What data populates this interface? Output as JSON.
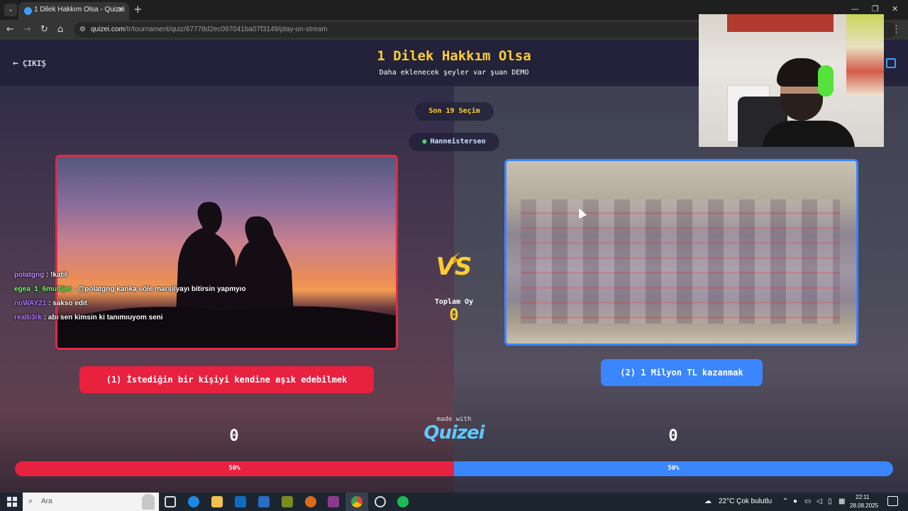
{
  "browser": {
    "tab_title": "1 Dilek Hakkım Olsa - Quizei",
    "new_tab_symbol": "+",
    "close_symbol": "✕",
    "url_domain": "quizei.com",
    "url_path": "/tr/tournament/quiz/67778d2ec097041ba07f3149/play-on-stream"
  },
  "header": {
    "exit_label": "ÇIKIŞ",
    "title": "1 Dilek Hakkım Olsa",
    "subtitle": "Daha eklenecek şeyler var şuan DEMO"
  },
  "pills": {
    "recent": "Son 19 Seçim",
    "user": "Hanneisterseo"
  },
  "center": {
    "vs": "VS",
    "total_label": "Toplam Oy",
    "total_value": "0",
    "made_with": "made with",
    "logo": "Quizei"
  },
  "options": [
    {
      "label": "(1) İstediğin bir kişiyi kendine aşık edebilmek",
      "score": "0",
      "percent_label": "50%",
      "percent": 50,
      "color": "#e8213f"
    },
    {
      "label": "(2) 1 Milyon TL kazanmak",
      "score": "0",
      "percent_label": "50%",
      "percent": 50,
      "color": "#3a86ff"
    }
  ],
  "chat": [
    {
      "user": "polatgng",
      "message": ": !katil",
      "color": "#c58cff"
    },
    {
      "user": "egea_1_6multijet",
      "message": ": @polatgng kanka söle marsilyayı bitirsin yapmyıo",
      "color": "#7dff6a"
    },
    {
      "user": "noWAY21",
      "message": ": sakso edit",
      "color": "#a87bff"
    },
    {
      "user": "realb3rk",
      "message": ": abı sen kimsin ki tanımıuyom seni",
      "color": "#b77dff"
    }
  ],
  "taskbar": {
    "search_placeholder": "Ara",
    "weather": "22°C  Çok bulutlu",
    "time": "22:11",
    "date": "28.08.2025"
  },
  "colors": {
    "accent_yellow": "#ffce2e",
    "red": "#e8213f",
    "blue": "#3a86ff"
  }
}
